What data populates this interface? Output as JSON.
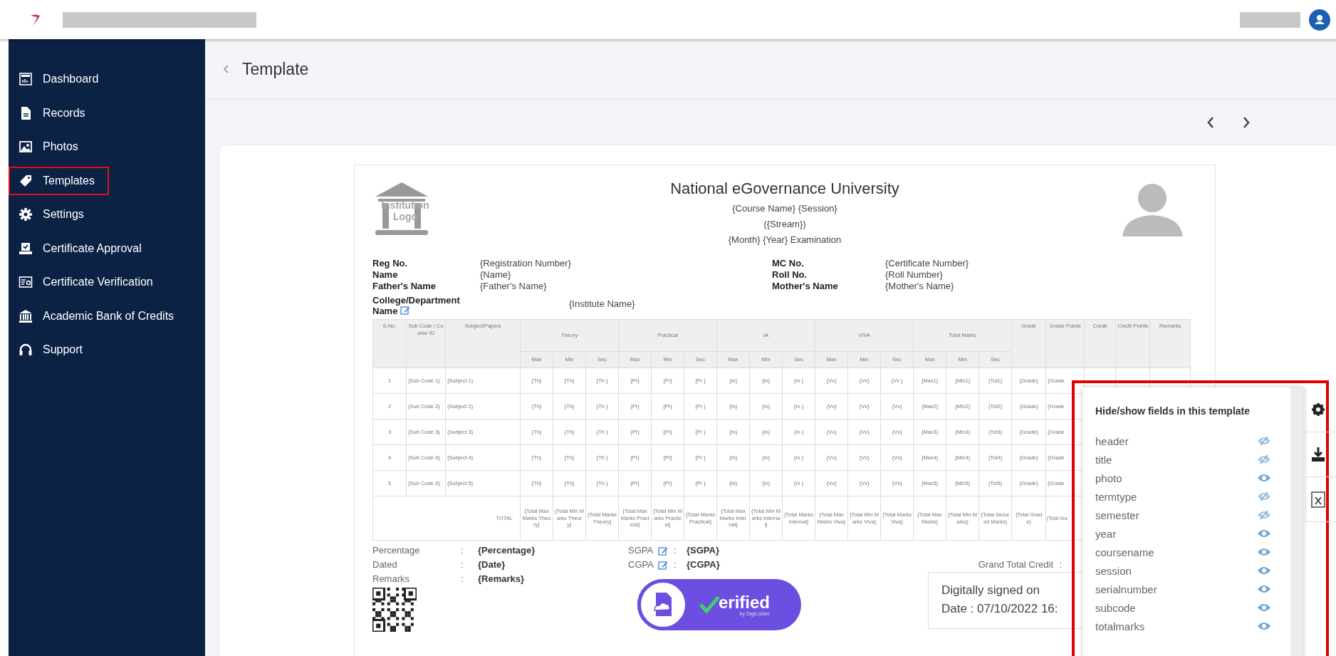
{
  "sidebar": {
    "items": [
      {
        "label": "Dashboard",
        "highlighted": false
      },
      {
        "label": "Records",
        "highlighted": false
      },
      {
        "label": "Photos",
        "highlighted": false
      },
      {
        "label": "Templates",
        "highlighted": true
      },
      {
        "label": "Settings",
        "highlighted": false
      },
      {
        "label": "Certificate Approval",
        "highlighted": false
      },
      {
        "label": "Certificate Verification",
        "highlighted": false
      },
      {
        "label": "Academic Bank of Credits",
        "highlighted": false
      },
      {
        "label": "Support",
        "highlighted": false
      }
    ]
  },
  "page": {
    "title": "Template"
  },
  "certificate": {
    "university": "National eGovernance University",
    "subtitle_lines": [
      "{Course Name} {Session}",
      "({Stream})",
      "{Month} {Year} Examination"
    ],
    "logo_text": "Institution Logo",
    "fields_left": [
      {
        "label": "Reg No.",
        "value": "{Registration Number}"
      },
      {
        "label": "Name",
        "value": "{Name}"
      },
      {
        "label": "Father's Name",
        "value": "{Father's Name}"
      }
    ],
    "fields_right": [
      {
        "label": "MC No.",
        "value": "{Certificate Number}"
      },
      {
        "label": "Roll No.",
        "value": "{Roll Number}"
      },
      {
        "label": "Mother's Name",
        "value": "{Mother's Name}"
      }
    ],
    "college": {
      "label": "College/Department Name",
      "value": "{Institute Name}"
    },
    "table": {
      "groups": [
        {
          "label": "S.No."
        },
        {
          "label": "Sub Code / Course ID"
        },
        {
          "label": "Subject/Papers"
        },
        {
          "label": "Theory",
          "sub": [
            "Max",
            "Min",
            "Sec"
          ]
        },
        {
          "label": "Practical",
          "sub": [
            "Max",
            "Min",
            "Sec"
          ]
        },
        {
          "label": "IA",
          "sub": [
            "Max",
            "Min",
            "Sec"
          ]
        },
        {
          "label": "VIVA",
          "sub": [
            "Max",
            "Min",
            "Sec"
          ]
        },
        {
          "label": "Total Marks",
          "sub": [
            "Max",
            "Min",
            "Sec"
          ]
        },
        {
          "label": "Grade"
        },
        {
          "label": "Grade Points"
        },
        {
          "label": "Credit"
        },
        {
          "label": "Credit Points"
        },
        {
          "label": "Remarks"
        }
      ],
      "rows": [
        [
          "1",
          "{Sub Code 1}",
          "{Subject 1}",
          "{Th}",
          "{Th}",
          "{Th }",
          "{Pr}",
          "{Pr}",
          "{Pr }",
          "{In}",
          "{In}",
          "{In }",
          "{Vv}",
          "{Vv}",
          "{Vv }",
          "{Max1}",
          "{Min1}",
          "{Tot1}",
          "{Grade}",
          "{Grade"
        ],
        [
          "2",
          "{Sub Code 2}",
          "{Subject 2}",
          "{Th}",
          "{Th}",
          "{Th }",
          "{Pr}",
          "{Pr}",
          "{Pr }",
          "{In}",
          "{In}",
          "{In }",
          "{Vv}",
          "{Vv}",
          "{Vv}",
          "{Max2}",
          "{Min2}",
          "{Tot2}",
          "{Grade}",
          "{Grade"
        ],
        [
          "3",
          "{Sub Code 3}",
          "{Subject 3}",
          "{Th}",
          "{Th}",
          "{Th }",
          "{Pr}",
          "{Pr}",
          "{Pr }",
          "{In}",
          "{In}",
          "{In }",
          "{Vv}",
          "{Vv}",
          "{Vv}",
          "{Max3}",
          "{Min3}",
          "{Tot3}",
          "{Grade}",
          "{Grade"
        ],
        [
          "4",
          "{Sub Code 4}",
          "{Subject 4}",
          "{Th}",
          "{Th}",
          "{Th }",
          "{Pr}",
          "{Pr}",
          "{Pr }",
          "{In}",
          "{In}",
          "{In }",
          "{Vv}",
          "{Vv}",
          "{Vv}",
          "{Max4}",
          "{Min4}",
          "{Tot4}",
          "{Grade}",
          "{Grade"
        ],
        [
          "5",
          "{Sub Code 5}",
          "{Subject 5}",
          "{Th}",
          "{Th}",
          "{Th }",
          "{Pr}",
          "{Pr}",
          "{Pr }",
          "{In}",
          "{In}",
          "{In }",
          "{Vv}",
          "{Vv}",
          "{Vv}",
          "{Max5}",
          "{Min5}",
          "{Tot5}",
          "{Grade}",
          "{Grade"
        ]
      ],
      "total": {
        "label": "TOTAL",
        "cells": [
          "{Total Max Marks Theory}",
          "{Total Min Marks Theory}",
          "{Total Marks Theory}",
          "{Total Max Marks Practical}",
          "{Total Min Marks Practical}",
          "{Total Marks Practical}",
          "{Total Max Marks Internal}",
          "{Total Min Marks Internal}",
          "{Total Marks Internal}",
          "{Total Max Marks Viva}",
          "{Total Min Marks Viva}",
          "{Total Marks Viva}",
          "{Total Max Marks}",
          "{Total Min Marks}",
          "{Total Secured Marks}",
          "{Total Grade}",
          "{Total Gra"
        ]
      }
    },
    "summary_left": [
      {
        "label": "Percentage",
        "sep": ":",
        "value": "{Percentage}"
      },
      {
        "label": "Dated",
        "sep": ":",
        "value": "{Date}"
      },
      {
        "label": "Remarks",
        "sep": ":",
        "value": "{Remarks}"
      }
    ],
    "summary_right": [
      {
        "label": "SGPA",
        "sep": ":",
        "value": "{SGPA}"
      },
      {
        "label": "CGPA",
        "sep": ":",
        "value": "{CGPA}"
      }
    ],
    "grand_total": {
      "label": "Grand Total Credit",
      "sep": ":"
    },
    "badge": {
      "text": "erified",
      "subtext": "by DigiLocker"
    },
    "signature": [
      "Digitally signed on",
      "Date : 07/10/2022 16:"
    ]
  },
  "fields_panel": {
    "title": "Hide/show fields in this template",
    "fields": [
      {
        "name": "header",
        "visible": false
      },
      {
        "name": "title",
        "visible": false
      },
      {
        "name": "photo",
        "visible": true
      },
      {
        "name": "termtype",
        "visible": false
      },
      {
        "name": "semester",
        "visible": false
      },
      {
        "name": "year",
        "visible": true
      },
      {
        "name": "coursename",
        "visible": true
      },
      {
        "name": "session",
        "visible": true
      },
      {
        "name": "serialnumber",
        "visible": true
      },
      {
        "name": "subcode",
        "visible": true
      },
      {
        "name": "totalmarks",
        "visible": true
      }
    ]
  }
}
